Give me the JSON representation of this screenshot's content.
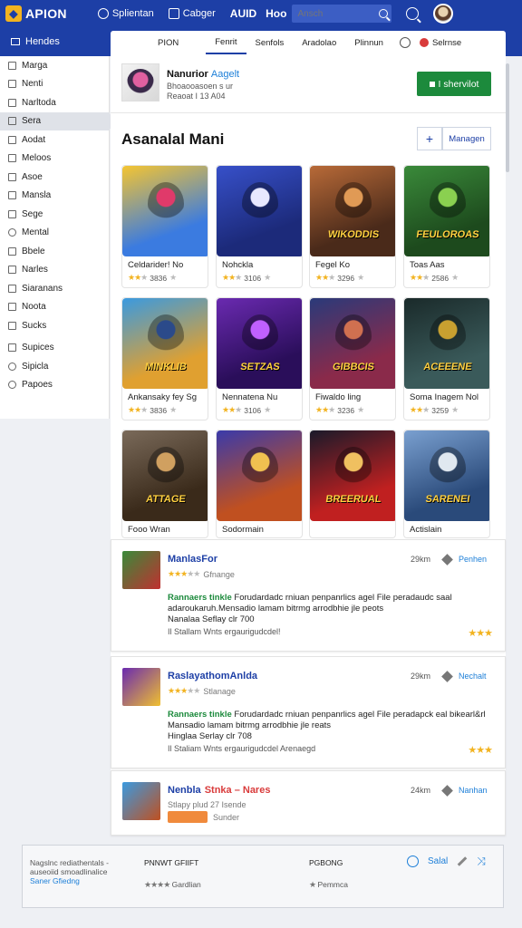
{
  "topbar": {
    "logo": "APION",
    "nav": [
      {
        "label": "Splientan",
        "icon": "compass-icon"
      },
      {
        "label": "Cabger",
        "icon": "window-icon"
      }
    ],
    "brand2": "AUID",
    "brand3": "Hoo",
    "search_placeholder": "Ansch"
  },
  "subbar": {
    "home": "Hendes"
  },
  "tabs": [
    "PION",
    "Fenrit",
    "Senfols",
    "Aradolao",
    "Plinnun"
  ],
  "tabs_end": "Selrnse",
  "sidebar": [
    {
      "label": "Marga",
      "icon": "list-icon"
    },
    {
      "label": "Nenti",
      "icon": "grid-icon"
    },
    {
      "label": "Narltoda",
      "icon": "pencil-icon"
    },
    {
      "label": "Sera",
      "icon": "box-icon",
      "active": true
    },
    {
      "label": "Aodat",
      "icon": "doc-icon"
    },
    {
      "label": "Meloos",
      "icon": "list-icon"
    },
    {
      "label": "Asoe",
      "icon": "folder-icon"
    },
    {
      "label": "Mansla",
      "icon": "image-icon"
    },
    {
      "label": "Sege",
      "icon": "doc-icon"
    },
    {
      "label": "Mental",
      "icon": "circle-icon"
    },
    {
      "label": "Bbele",
      "icon": "x-icon"
    },
    {
      "label": "Narles",
      "icon": "list-icon"
    },
    {
      "label": "Siaranans",
      "icon": "table-icon"
    },
    {
      "label": "Noota",
      "icon": "doc-icon"
    },
    {
      "label": "Sucks",
      "icon": "chart-icon"
    },
    {
      "label": "Supices",
      "icon": "share-icon"
    },
    {
      "label": "Sipicla",
      "icon": "globe-icon"
    },
    {
      "label": "Papoes",
      "icon": "globe-icon"
    }
  ],
  "app": {
    "title": "Nanurior",
    "title_highlight": "Aagelt",
    "sub1": "Bhoaooasoen s ur",
    "sub2": "Reaoat I 13 A04",
    "install_label": "I shervilot"
  },
  "section": {
    "title": "Asanalal Mani",
    "plus_label": "+",
    "manage_label": "Managen"
  },
  "cards": [
    {
      "name": "Celdarider! No",
      "rating": "3836",
      "art_text": "",
      "colors": [
        "#f5c531",
        "#3b7be0",
        "#e03a6a"
      ]
    },
    {
      "name": "Nohckla",
      "rating": "3106",
      "art_text": "",
      "colors": [
        "#3750c9",
        "#1c2a7a",
        "#e8e8ff"
      ]
    },
    {
      "name": "Fegel Ko",
      "rating": "3296",
      "art_text": "WIKODDIS",
      "colors": [
        "#b86a38",
        "#4a2a1a",
        "#e09a55"
      ]
    },
    {
      "name": "Toas Aas",
      "rating": "2586",
      "art_text": "FEULOROAS",
      "colors": [
        "#3a8a3a",
        "#1d4a1d",
        "#8ad050"
      ]
    },
    {
      "name": "Ankansaky fey Sg",
      "rating": "3836",
      "art_text": "MINKLIB",
      "colors": [
        "#3a9ae0",
        "#e0a030",
        "#2b4a8a"
      ]
    },
    {
      "name": "Nennatena Nu",
      "rating": "3106",
      "art_text": "SETZAS",
      "colors": [
        "#6a2ab0",
        "#2a0e5a",
        "#c060ff"
      ]
    },
    {
      "name": "Fiwaldo ling",
      "rating": "3236",
      "art_text": "GIBBCIS",
      "colors": [
        "#2a3a7a",
        "#8a2a4a",
        "#d07050"
      ]
    },
    {
      "name": "Soma Inagem Nol",
      "rating": "3259",
      "art_text": "ACEEENE",
      "colors": [
        "#1a2a2a",
        "#3a5a5a",
        "#c8a030"
      ]
    },
    {
      "name": "Fooo Wran",
      "rating": "",
      "art_text": "ATTAGE",
      "colors": [
        "#7a6a5a",
        "#3a2a1a",
        "#d0a060"
      ]
    },
    {
      "name": "Sodormain",
      "rating": "",
      "art_text": "",
      "colors": [
        "#3a3aaa",
        "#c05020",
        "#f0c050"
      ]
    },
    {
      "name": "",
      "rating": "",
      "art_text": "BREERUAL",
      "colors": [
        "#1a1a2a",
        "#c02020",
        "#f0c060"
      ]
    },
    {
      "name": "Actislain",
      "rating": "",
      "art_text": "SARENEI",
      "colors": [
        "#7aa0d0",
        "#2a4a7a",
        "#e0e8f0"
      ]
    }
  ],
  "reviews": [
    {
      "title": "ManlasFor",
      "sub": "Gfnange",
      "date": "29km",
      "action": "Penhen",
      "green": "Rannaers tinkle",
      "body": "Forudardadc rniuan penpanrlics agel File peradaudc saal adaroukaruh.Mensadio lamam bitrmg arrodbhie jle peots",
      "line3": "Nanalaa Seflay clr 700",
      "foot": "Il Stallam Wnts ergaurigudcdel!",
      "title_color": "#1d3fa6",
      "thumb": [
        "#3a8a3a",
        "#c03030"
      ]
    },
    {
      "title": "RaslayathomAnlda",
      "sub": "Stlanage",
      "date": "29km",
      "action": "Nechalt",
      "green": "Rannaers tinkle",
      "body": "Forudardadc rniuan penpanrlics agel File peradapck eal bikearl&rl Mansadio lamam bitrmg arrodbhie jle reats",
      "line3": "Hinglaa Serlay clr 708",
      "foot": "Il Staliam Wnts ergaurigudcdel Arenaegd",
      "title_color": "#1d3fa6",
      "thumb": [
        "#6a2ab0",
        "#f0c030"
      ]
    },
    {
      "title": "Nenbla",
      "title2": "Stnka – Nares",
      "date": "24km",
      "action": "Nanhan",
      "sub": "Stlapy plud 27 Isende",
      "badge": "",
      "badge_after": "Sunder",
      "title_color": "#1d3fa6",
      "thumb": [
        "#3a9ae0",
        "#c05020"
      ]
    }
  ],
  "bottom": {
    "left_line1": "Nagslnc rediathentals -",
    "left_line2": "auseoiid smoadlinalice",
    "left_link": "Saner Gfiedng",
    "col1_title": "PNNWT GFIIFT",
    "col1_row2": "Gardlian",
    "col2_title": "PGBONG",
    "col2_row2": "Pemmca",
    "action_label": "Salal"
  }
}
